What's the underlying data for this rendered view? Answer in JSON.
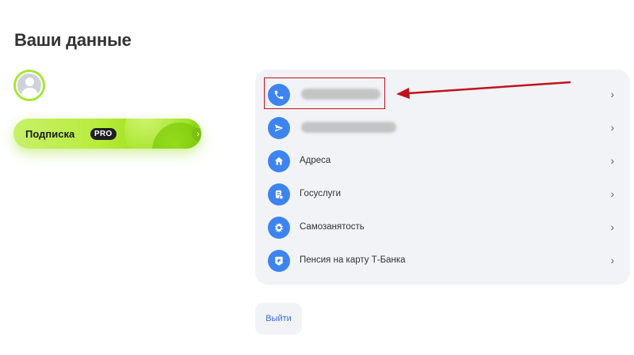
{
  "page": {
    "title": "Ваши данные"
  },
  "subscription": {
    "label": "Подписка",
    "badge": "PRO"
  },
  "contacts": [
    {
      "icon": "phone-icon",
      "label": ""
    },
    {
      "icon": "send-icon",
      "label": ""
    },
    {
      "icon": "home-icon",
      "label": "Адреса"
    },
    {
      "icon": "gosuslugi-icon",
      "label": "Госуслуги"
    },
    {
      "icon": "emblem-icon",
      "label": "Самозанятость"
    },
    {
      "icon": "ruble-icon",
      "label": "Пенсия на карту Т-Банка"
    }
  ],
  "logout": {
    "label": "Выйти"
  },
  "colors": {
    "accent_green": "#a5e637",
    "icon_blue": "#3d84f0",
    "highlight_red": "#c0121b",
    "panel_bg": "#f2f3f7"
  }
}
